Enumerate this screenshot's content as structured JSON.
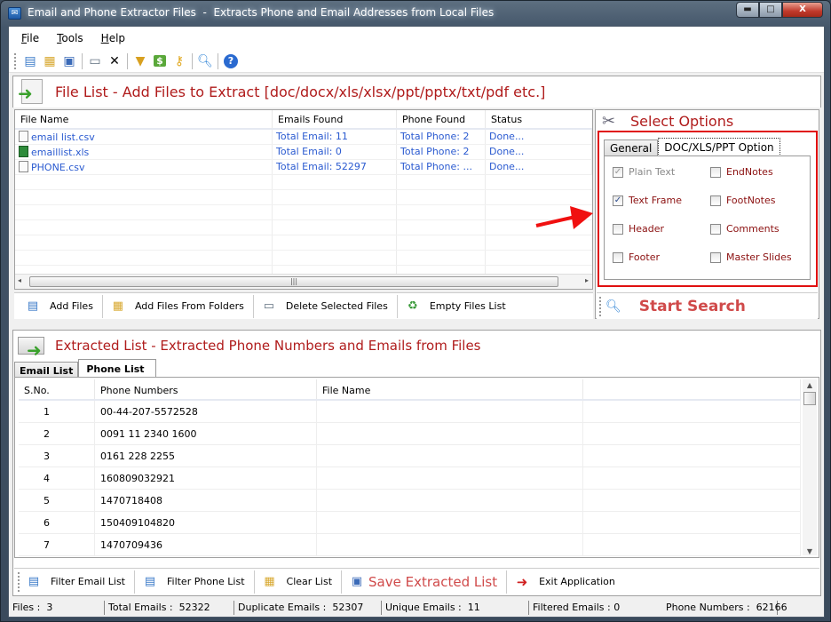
{
  "window": {
    "title": "Email and Phone Extractor Files  -  Extracts Phone and Email Addresses from Local Files",
    "buttons": {
      "minimize": "▬",
      "maximize": "□",
      "close": "X"
    }
  },
  "menubar": [
    {
      "label": "File",
      "mnemonic": "F",
      "rest": "ile"
    },
    {
      "label": "Tools",
      "mnemonic": "T",
      "rest": "ools"
    },
    {
      "label": "Help",
      "mnemonic": "H",
      "rest": "elp"
    }
  ],
  "toolbar_icons": [
    "add-files-icon",
    "add-folder-icon",
    "save-icon",
    "delete-files-icon",
    "clear-icon",
    "filter-icon",
    "dollar-icon",
    "key-icon",
    "search-icon",
    "help-icon"
  ],
  "file_list": {
    "header": "File List - Add Files to Extract  [doc/docx/xls/xlsx/ppt/pptx/txt/pdf etc.]",
    "columns": [
      "File Name",
      "Emails Found",
      "Phone Found",
      "Status"
    ],
    "rows": [
      {
        "name": "email list.csv",
        "type": "csv",
        "emails": "Total Email: 11",
        "phones": "Total Phone: 2",
        "status": "Done..."
      },
      {
        "name": "emaillist.xls",
        "type": "xls",
        "emails": "Total Email: 0",
        "phones": "Total Phone: 2",
        "status": "Done..."
      },
      {
        "name": "PHONE.csv",
        "type": "csv",
        "emails": "Total Email: 52297",
        "phones": "Total Phone: ...",
        "status": "Done..."
      }
    ],
    "scroll_thumb": "|||",
    "buttons": [
      {
        "label": "Add Files",
        "icon": "add-files-icon"
      },
      {
        "label": "Add Files From Folders",
        "icon": "add-folder-icon"
      },
      {
        "label": "Delete Selected Files",
        "icon": "delete-files-icon"
      },
      {
        "label": "Empty Files List",
        "icon": "recycle-icon"
      }
    ]
  },
  "options": {
    "header": "Select Options",
    "tabs": [
      "General",
      "DOC/XLS/PPT Option"
    ],
    "active_tab": "DOC/XLS/PPT Option",
    "checkboxes": [
      {
        "label": "Plain Text",
        "checked": true,
        "disabled": true
      },
      {
        "label": "EndNotes",
        "checked": false,
        "disabled": false
      },
      {
        "label": "Text Frame",
        "checked": true,
        "disabled": false
      },
      {
        "label": "FootNotes",
        "checked": false,
        "disabled": false
      },
      {
        "label": "Header",
        "checked": false,
        "disabled": false
      },
      {
        "label": "Comments",
        "checked": false,
        "disabled": false
      },
      {
        "label": "Footer",
        "checked": false,
        "disabled": false
      },
      {
        "label": "Master Slides",
        "checked": false,
        "disabled": false
      }
    ],
    "start_search": "Start Search"
  },
  "extracted": {
    "header": "Extracted List - Extracted Phone Numbers and Emails from Files",
    "tabs": [
      "Email List",
      "Phone List"
    ],
    "active_tab": "Phone List",
    "columns": [
      "S.No.",
      "Phone Numbers",
      "File Name"
    ],
    "rows": [
      {
        "sno": "1",
        "phone": "00-44-207-5572528",
        "file": ""
      },
      {
        "sno": "2",
        "phone": "0091 11 2340 1600",
        "file": ""
      },
      {
        "sno": "3",
        "phone": "0161 228 2255",
        "file": ""
      },
      {
        "sno": "4",
        "phone": "160809032921",
        "file": ""
      },
      {
        "sno": "5",
        "phone": "1470718408",
        "file": ""
      },
      {
        "sno": "6",
        "phone": "150409104820",
        "file": ""
      },
      {
        "sno": "7",
        "phone": "1470709436",
        "file": ""
      }
    ],
    "buttons": [
      {
        "label": "Filter Email List",
        "icon": "filter-email-icon"
      },
      {
        "label": "Filter Phone List",
        "icon": "filter-phone-icon"
      },
      {
        "label": "Clear List",
        "icon": "clear-list-icon"
      },
      {
        "label": "Save Extracted List",
        "icon": "save-list-icon",
        "highlight": true
      },
      {
        "label": "Exit Application",
        "icon": "exit-icon"
      }
    ]
  },
  "status": {
    "files": "Files :  3",
    "total_emails": "Total Emails :  52322",
    "duplicate_emails": "Duplicate Emails :  52307",
    "unique_emails": "Unique Emails :  11",
    "filtered_emails": "Filtered Emails : 0",
    "phone_numbers": "Phone Numbers :  62166"
  },
  "colors": {
    "accent_red": "#b01c1c",
    "link_blue": "#2a5ad0",
    "annotation_red": "#e01010"
  }
}
